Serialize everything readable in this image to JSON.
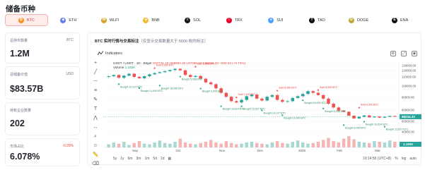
{
  "page": {
    "title": "储备币种"
  },
  "tabs": [
    {
      "label": "BTC",
      "icon": "bitcoin-icon",
      "symbol": "₿",
      "color": "#f7931a",
      "active": true
    },
    {
      "label": "ETH",
      "icon": "ethereum-icon",
      "symbol": "◆",
      "color": "#627eea",
      "active": false
    },
    {
      "label": "WLFI",
      "icon": "wlfi-icon",
      "symbol": "W",
      "color": "#d4a62a",
      "active": false
    },
    {
      "label": "BNB",
      "icon": "bnb-icon",
      "symbol": "◈",
      "color": "#f3ba2f",
      "active": false
    },
    {
      "label": "SOL",
      "icon": "solana-icon",
      "symbol": "≡",
      "color": "#14151a",
      "active": false
    },
    {
      "label": "TRX",
      "icon": "tron-icon",
      "symbol": "▽",
      "color": "#ef0027",
      "active": false
    },
    {
      "label": "SUI",
      "icon": "sui-icon",
      "symbol": "●",
      "color": "#4da2ff",
      "active": false
    },
    {
      "label": "TAO",
      "icon": "tao-icon",
      "symbol": "T",
      "color": "#111111",
      "active": false
    },
    {
      "label": "DOGE",
      "icon": "doge-icon",
      "symbol": "Ð",
      "color": "#c2a633",
      "active": false
    },
    {
      "label": "ENA",
      "icon": "ena-icon",
      "symbol": "E",
      "color": "#111111",
      "active": false
    }
  ],
  "cards": [
    {
      "label": "总持币数量",
      "tag": "BTC",
      "value": "1.2M"
    },
    {
      "label": "总储备价值",
      "tag": "USD",
      "value": "$83.57B"
    },
    {
      "label": "持有企业数量",
      "tag": "",
      "value": "202"
    },
    {
      "label": "市场占比",
      "tag": "-0.20%",
      "value": "6.078%"
    }
  ],
  "chart_panel": {
    "title": "BTC 实时行情与交易标注",
    "subtitle": "（仅显示交易数量大于 5000 枚的标注）",
    "indicators_label": "Indicators",
    "legend_symbol": "USDT / USDT · 1D · Bitget",
    "legend_ohlc": "O67731.16 H68994.32 L67480.17 C68234.33 +503.62 (+0.74%)",
    "volume_label": "Volume",
    "volume_value": "1.193K",
    "price_tag": "68234.33",
    "volume_tag": "1.193K",
    "timeframes": [
      "5y",
      "1y",
      "6m",
      "3m",
      "1m",
      "5d",
      "1d"
    ],
    "time_display": "10:14:55 (UTC+8)",
    "log_label": "log",
    "auto_label": "auto"
  },
  "chart_data": {
    "type": "candlestick",
    "y_axis_ticks": [
      130000,
      120000,
      110000,
      100000,
      90000,
      80000,
      60000,
      40000
    ],
    "x_axis_labels": [
      "Sep",
      "Oct",
      "Nov",
      "Dec",
      "2026",
      "Feb",
      "Mar"
    ],
    "close_series": [
      111000,
      113000,
      109000,
      112000,
      115000,
      110000,
      108500,
      111000,
      114000,
      116000,
      117500,
      119000,
      121000,
      123500,
      120500,
      113000,
      110000,
      111500,
      108000,
      104000,
      102000,
      98000,
      94000,
      90500,
      87000,
      86000,
      88000,
      91000,
      92500,
      89000,
      87500,
      90500,
      92000,
      88000,
      86500,
      87000,
      89500,
      91000,
      93000,
      95500,
      94000,
      92000,
      89000,
      85000,
      82000,
      79000,
      77000,
      70000,
      65000,
      68000,
      70500,
      67000,
      68500,
      66500,
      68000,
      69500,
      68234
    ],
    "annotations": {
      "green": [
        "Bought 10,107 BTC",
        "Bought 11,000 BTC",
        "Bought 18,000 BTC",
        "Bought 5,268 BTC",
        "Bought 6,000 BTC",
        "Bought 10,624 BTC",
        "Bought 13,627 BTC"
      ],
      "red": [
        "Sold 5,000 BTC",
        "Sold 6,500 BTC",
        "Sold 7,200 BTC",
        "Sold 8,000 BTC"
      ]
    }
  }
}
